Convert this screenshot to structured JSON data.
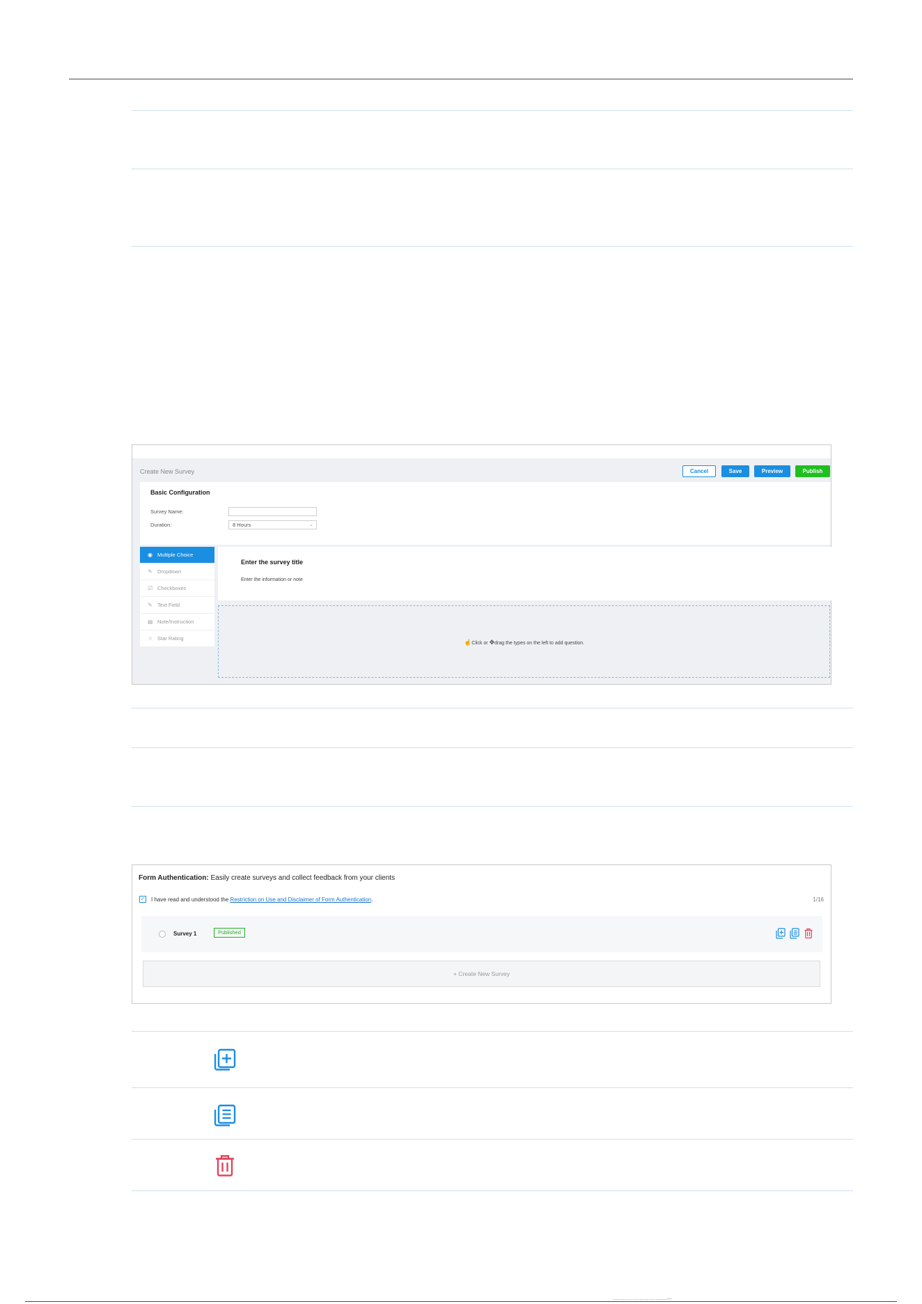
{
  "create_survey": {
    "title": "Create New Survey",
    "buttons": {
      "cancel": "Cancel",
      "save": "Save",
      "preview": "Preview",
      "publish": "Publish"
    },
    "basic": {
      "heading": "Basic Configuration",
      "survey_name_label": "Survey Name:",
      "survey_name_value": "",
      "duration_label": "Duration:",
      "duration_value": "8 Hours"
    },
    "question_types": [
      {
        "label": "Multiple Choice",
        "icon": "radio-icon",
        "active": true
      },
      {
        "label": "Dropdown",
        "icon": "edit-icon",
        "active": false
      },
      {
        "label": "Checkboxes",
        "icon": "checkbox-icon",
        "active": false
      },
      {
        "label": "Text Field",
        "icon": "edit-icon",
        "active": false
      },
      {
        "label": "Note/Instruction",
        "icon": "note-icon",
        "active": false
      },
      {
        "label": "Star Rating",
        "icon": "star-icon",
        "active": false
      }
    ],
    "survey_title_placeholder": "Enter the survey title",
    "survey_note_placeholder": "Enter the information or note",
    "drop_hint_click": "Click or",
    "drop_hint_drag": "drag the types on the left to add question."
  },
  "form_auth": {
    "title_bold": "Form Authentication:",
    "title_rest": " Easily create surveys and collect feedback from your clients",
    "agree_prefix": "I have read and understood the ",
    "agree_link": "Restriction on Use and Disclaimer of Form Authentication",
    "agree_suffix": ".",
    "count": "1/16",
    "survey": {
      "name": "Survey 1",
      "status": "Published"
    },
    "create_label": "+ Create New Survey"
  },
  "legend_icons": [
    "add-copy-icon",
    "copy-icon",
    "delete-icon"
  ],
  "colors": {
    "accent": "#1a8ee1",
    "publish": "#1fbf1f",
    "delete": "#e0445a"
  },
  "footer_mark": "...............................................—"
}
